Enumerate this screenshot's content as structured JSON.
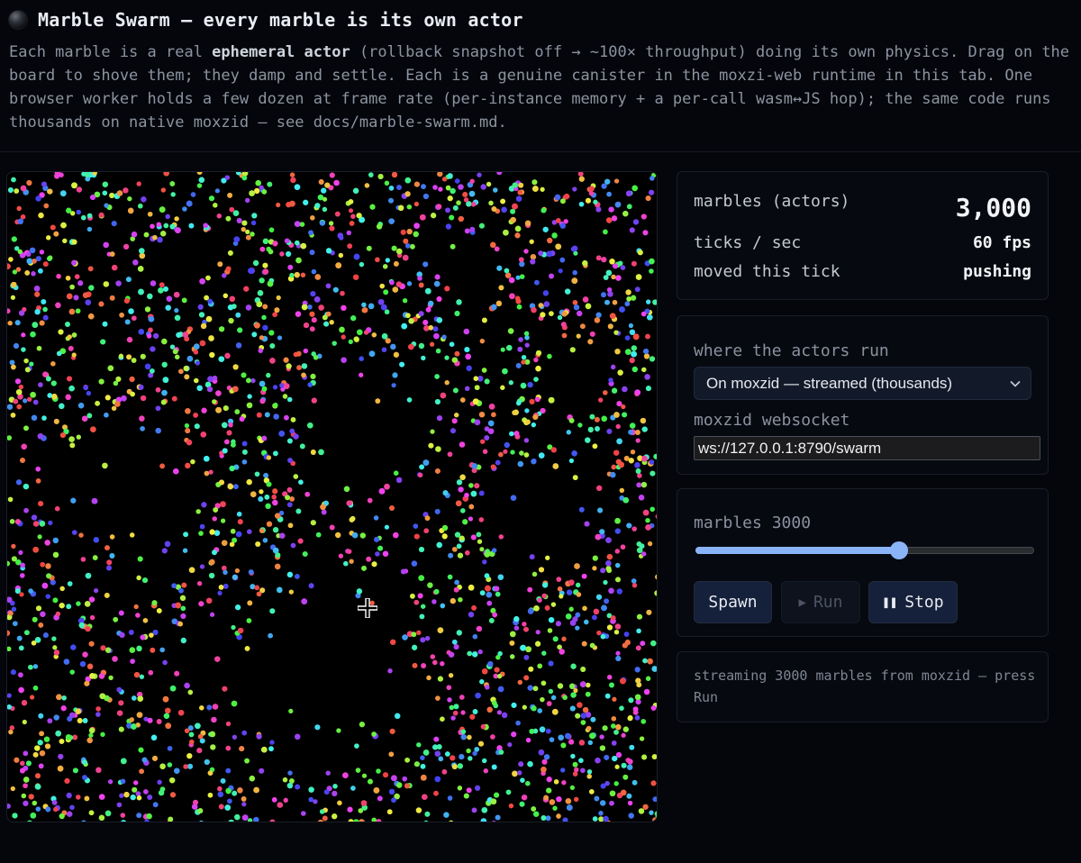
{
  "header": {
    "title": "Marble Swarm — every marble is its own actor",
    "desc_prefix": "Each marble is a real ",
    "desc_bold": "ephemeral actor",
    "desc_rest": " (rollback snapshot off → ~100× throughput) doing its own physics. Drag on the board to shove them; they damp and settle. Each is a genuine canister in the moxzi-web runtime in this tab. One browser worker holds a few dozen at frame rate (per-instance memory + a per-call wasm↔JS hop); the same code runs thousands on native moxzid — see docs/marble-swarm.md."
  },
  "stats": {
    "marbles_label": "marbles (actors)",
    "marbles_value": "3,000",
    "ticks_label": "ticks / sec",
    "ticks_value": "60 fps",
    "moved_label": "moved this tick",
    "moved_value": "pushing"
  },
  "runtime": {
    "label": "where the actors run",
    "selected": "On moxzid — streamed (thousands)",
    "ws_label": "moxzid websocket",
    "ws_value": "ws://127.0.0.1:8790/swarm"
  },
  "controls": {
    "marbles_label": "marbles 3000",
    "slider_value": 3000,
    "slider_fraction": 0.6,
    "spawn_label": "Spawn",
    "run_label": "Run",
    "stop_label": "Stop"
  },
  "status": {
    "text": "streaming 3000 marbles from moxzid — press Run"
  },
  "icons": {
    "title": "marble-icon",
    "cursor": "crosshair-cursor-icon",
    "dropdown": "chevron-down-icon",
    "run": "play-icon",
    "stop": "pause-icon"
  },
  "colors": {
    "background": "#04060b",
    "accent": "#8ab4f8",
    "button": "#15203a"
  }
}
